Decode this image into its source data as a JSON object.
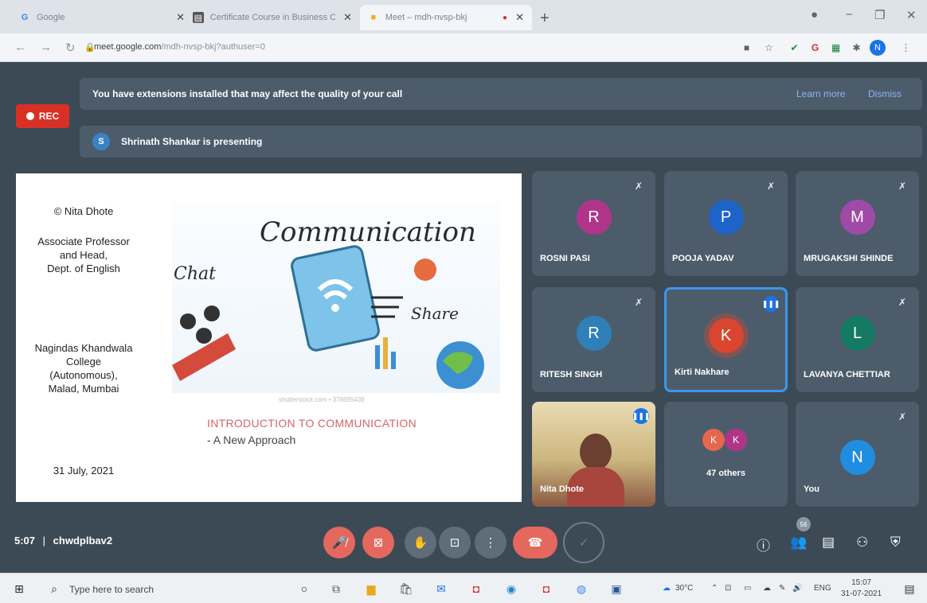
{
  "browser": {
    "tabs": [
      {
        "label": "Google",
        "favicon": "google-g-icon"
      },
      {
        "label": "Certificate Course in Business Co",
        "favicon": "doc-icon"
      },
      {
        "label": "Meet – mdh-nvsp-bkj",
        "favicon": "meet-icon"
      }
    ],
    "url_host": "meet.google.com",
    "url_path": "/mdh-nvsp-bkj?authuser=0",
    "profile_initial": "N"
  },
  "meet": {
    "extensions_banner": "You have extensions installed that may affect the quality of your call",
    "learn_more": "Learn more",
    "dismiss": "Dismiss",
    "rec_label": "REC",
    "presenter_initial": "S",
    "presenting_text": "Shrinath Shankar is presenting",
    "slide": {
      "copyright": "© Nita Dhote",
      "role_line1": "Associate Professor",
      "role_line2": "and Head,",
      "role_line3": "Dept. of English",
      "college_line1": "Nagindas Khandwala",
      "college_line2": "College",
      "college_line3": "(Autonomous),",
      "college_line4": "Malad, Mumbai",
      "date": "31 July, 2021",
      "image_word": "Communication",
      "image_word_chat": "Chat",
      "image_word_share": "Share",
      "stock_credit": "shutterstock.com • 376695439",
      "title": "INTRODUCTION TO COMMUNICATION",
      "subtitle": "- A New Approach"
    },
    "participants": [
      {
        "name": "ROSNI PASI",
        "initial": "R",
        "color": "#b0358a",
        "muted": true
      },
      {
        "name": "POOJA YADAV",
        "initial": "P",
        "color": "#1e63c8",
        "muted": true
      },
      {
        "name": "MRUGAKSHI SHINDE",
        "initial": "M",
        "color": "#a04aa8",
        "muted": true
      },
      {
        "name": "RITESH SINGH",
        "initial": "R",
        "color": "#2f7fb8",
        "muted": true
      },
      {
        "name": "Kirti Nakhare",
        "initial": "K",
        "color": "#d9452f",
        "muted": false
      },
      {
        "name": "LAVANYA CHETTIAR",
        "initial": "L",
        "color": "#157a63",
        "muted": true
      },
      {
        "name": "Nita Dhote",
        "muted": false
      },
      {
        "name": "47 others",
        "initials": [
          "K",
          "K"
        ]
      },
      {
        "name": "You",
        "initial": "N",
        "color": "#1f8ee0",
        "muted": true
      }
    ],
    "meeting_time": "5:07",
    "meeting_code": "chwdplbav2",
    "participant_count": "56"
  },
  "taskbar": {
    "search_placeholder": "Type here to search",
    "weather": "30°C",
    "lang": "ENG",
    "time": "15:07",
    "date": "31-07-2021"
  }
}
